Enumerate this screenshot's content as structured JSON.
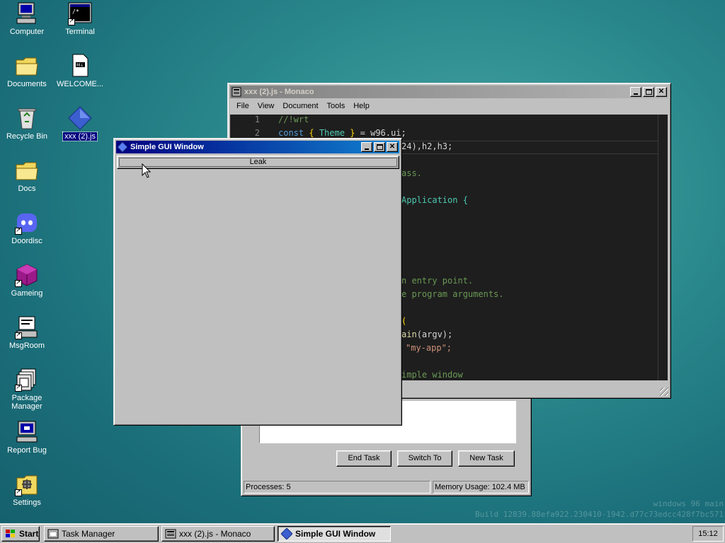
{
  "desktop": {
    "icons": [
      {
        "label": "Computer",
        "icon": "computer-icon"
      },
      {
        "label": "Terminal",
        "icon": "terminal-icon"
      },
      {
        "label": "Documents",
        "icon": "folder-icon"
      },
      {
        "label": "WELCOME...",
        "icon": "markdown-file-icon"
      },
      {
        "label": "Recycle Bin",
        "icon": "recycle-bin-icon"
      },
      {
        "label": "xxx (2).js",
        "icon": "js-file-icon"
      },
      {
        "label": "Docs",
        "icon": "folder-icon"
      },
      {
        "label": "Doordisc",
        "icon": "discord-icon"
      },
      {
        "label": "Gameing",
        "icon": "game-cube-icon"
      },
      {
        "label": "MsgRoom",
        "icon": "msgroom-icon"
      },
      {
        "label": "Package Manager",
        "icon": "package-manager-icon"
      },
      {
        "label": "Report Bug",
        "icon": "report-bug-icon"
      },
      {
        "label": "Settings",
        "icon": "settings-icon"
      }
    ],
    "watermark": {
      "line1": "windows 96 main",
      "line2": "Build 12839.88efa922.230410-1942.d77c73edcc428f7bc571"
    }
  },
  "monaco": {
    "title": "xxx (2).js - Monaco",
    "menu": [
      "File",
      "View",
      "Document",
      "Tools",
      "Help"
    ],
    "line_numbers": [
      "1",
      "2"
    ],
    "code_visible": {
      "l1": "//!wrt",
      "l2_kw": "const",
      "l2_open": "{",
      "l2_name": "Theme",
      "l2_close": "}",
      "l2_rest": " = w96.ui;",
      "l3": "24),h2,h3;",
      "l5": "ass.",
      "l7": "Application {",
      "l12": "n entry point.",
      "l13": "e program arguments.",
      "l15": "(",
      "l16a": "ain",
      "l16b": "(argv);",
      "l17": "\"my-app\";",
      "l19": "imple window"
    }
  },
  "taskmgr": {
    "buttons": {
      "end": "End Task",
      "switch": "Switch To",
      "new": "New Task"
    },
    "status": {
      "processes": "Processes: 5",
      "memory": "Memory Usage: 102.4 MB"
    }
  },
  "simplegui": {
    "title": "Simple GUI Window",
    "button_label": "Leak"
  },
  "taskbar": {
    "start": "Start",
    "tasks": [
      "Task Manager",
      "xxx (2).js - Monaco",
      "Simple GUI Window"
    ],
    "clock": "15:12"
  },
  "colors": {
    "titlebar_active": "#000080",
    "desktop_bg": "#2b8b8e",
    "editor_bg": "#1e1e1e"
  }
}
